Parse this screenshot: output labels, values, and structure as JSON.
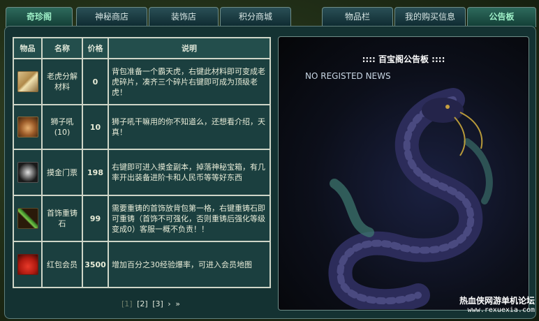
{
  "tabs_left": [
    {
      "label": "奇珍阁",
      "active": true
    },
    {
      "label": "神秘商店",
      "active": false
    },
    {
      "label": "装饰店",
      "active": false
    },
    {
      "label": "积分商城",
      "active": false
    }
  ],
  "tabs_right": [
    {
      "label": "物品栏",
      "active": false
    },
    {
      "label": "我的购买信息",
      "active": false
    },
    {
      "label": "公告板",
      "active": true
    }
  ],
  "table": {
    "headers": [
      "物品",
      "名称",
      "价格",
      "说明"
    ],
    "rows": [
      {
        "icon": "tiger-fragment-icon",
        "name": "老虎分解材料",
        "price": "0",
        "desc": "背包准备一个霸天虎，右键此材料即可变成老虎碎片，凑齐三个碎片右键即可成为顶级老虎！"
      },
      {
        "icon": "lion-roar-icon",
        "name": "狮子吼(10)",
        "price": "10",
        "desc": "狮子吼干嘛用的你不知道么，还想看介绍，天真！"
      },
      {
        "icon": "shuriken-ticket-icon",
        "name": "摸金门票",
        "price": "198",
        "desc": "右键即可进入摸金副本，掉落神秘宝箱，有几率开出装备进阶卡和人民币等等好东西"
      },
      {
        "icon": "jade-staff-icon",
        "name": "首饰重铸石",
        "price": "99",
        "desc": "需要重铸的首饰放背包第一格，右键重铸石即可重铸（首饰不可强化，否则重铸后强化等级变成0）客服一概不负责！！"
      },
      {
        "icon": "red-envelope-bag-icon",
        "name": "红包会员",
        "price": "3500",
        "desc": "增加百分之30经验爆率，可进入会员地图"
      }
    ]
  },
  "pager": {
    "current": "[1]",
    "pages": [
      "[2]",
      "[3]"
    ],
    "next": "›",
    "last": "»"
  },
  "notice": {
    "title": ":::: 百宝阁公告板 ::::",
    "text": "NO REGISTED NEWS"
  },
  "watermark": {
    "line1": "热血侠网游单机论坛",
    "line2": "www.rexuexia.com"
  },
  "colors": {
    "panel": "#143232",
    "active_tab_text": "#9ff0c8",
    "price_text": "#8fe0c0"
  }
}
